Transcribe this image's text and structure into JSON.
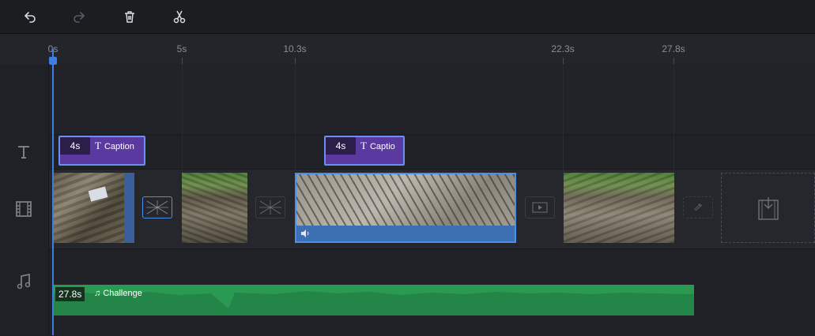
{
  "toolbar": {
    "undo_icon": "undo-icon",
    "redo_icon": "redo-icon",
    "delete_icon": "trash-icon",
    "split_icon": "scissors-icon"
  },
  "ruler": {
    "ticks": [
      "0s",
      "5s",
      "10.3s",
      "22.3s",
      "27.8s"
    ]
  },
  "tracks": {
    "text_icon": "text-icon",
    "video_icon": "film-icon",
    "audio_icon": "music-note-icon"
  },
  "captions": [
    {
      "duration": "4s",
      "label": "Caption"
    },
    {
      "duration": "4s",
      "label": "Captio"
    }
  ],
  "audio_clip": {
    "duration": "27.8s",
    "label": "Challenge"
  },
  "colors": {
    "accent": "#3d7fe0",
    "caption": "#5a3aa0",
    "audio": "#2a9a52"
  }
}
